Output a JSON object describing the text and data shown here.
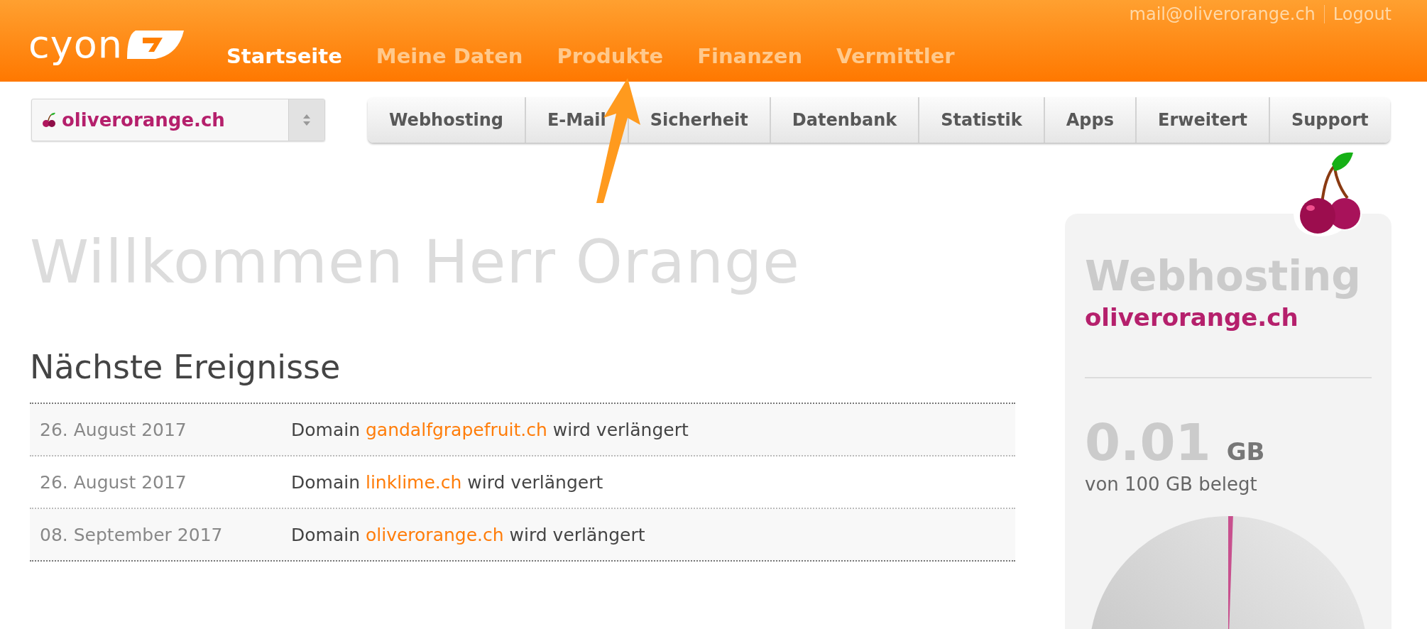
{
  "header": {
    "logo": "cyon",
    "nav": [
      {
        "label": "Startseite",
        "selected": true
      },
      {
        "label": "Meine Daten",
        "selected": false
      },
      {
        "label": "Produkte",
        "selected": false
      },
      {
        "label": "Finanzen",
        "selected": false
      },
      {
        "label": "Vermittler",
        "selected": false
      }
    ],
    "account": {
      "email": "mail@oliverorange.ch",
      "logout": "Logout"
    }
  },
  "domain_select": {
    "value": "oliverorange.ch"
  },
  "tabs": [
    {
      "label": "Webhosting"
    },
    {
      "label": "E-Mail"
    },
    {
      "label": "Sicherheit"
    },
    {
      "label": "Datenbank"
    },
    {
      "label": "Statistik"
    },
    {
      "label": "Apps"
    },
    {
      "label": "Erweitert"
    },
    {
      "label": "Support"
    }
  ],
  "welcome": "Willkommen Herr Orange",
  "events": {
    "title": "Nächste Ereignisse",
    "rows": [
      {
        "date": "26. August 2017",
        "prefix": "Domain",
        "domain": "gandalfgrapefruit.ch",
        "suffix": "wird verlängert"
      },
      {
        "date": "26. August 2017",
        "prefix": "Domain",
        "domain": "linklime.ch",
        "suffix": "wird verlängert"
      },
      {
        "date": "08. September 2017",
        "prefix": "Domain",
        "domain": "oliverorange.ch",
        "suffix": "wird verlängert"
      }
    ]
  },
  "card": {
    "title": "Webhosting",
    "domain": "oliverorange.ch",
    "usage": "0.01",
    "unit": "GB",
    "caption": "von 100 GB belegt"
  }
}
